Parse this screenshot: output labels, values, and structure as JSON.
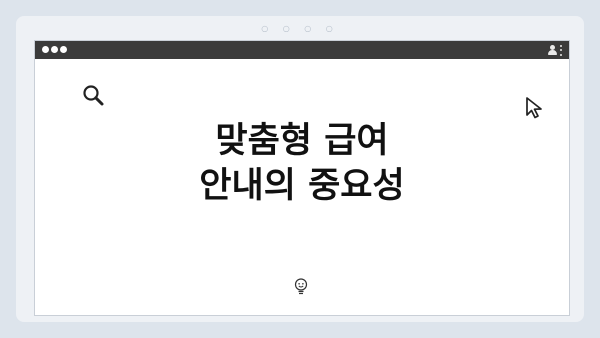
{
  "window": {
    "chrome_dots": "○ ○ ○ ○",
    "traffic_lights": [
      "close",
      "minimize",
      "maximize"
    ],
    "toolbar_icons": [
      "user-icon",
      "kebab-menu-icon"
    ]
  },
  "content": {
    "heading_line1": "맞춤형 급여",
    "heading_line2": "안내의 중요성"
  },
  "decor_icons": [
    "search-icon",
    "cursor-icon",
    "lightbulb-face-icon"
  ],
  "colors": {
    "page_background": "#dde4ec",
    "titlebar": "#3b3b3b",
    "content_background": "#ffffff",
    "text": "#111111"
  }
}
